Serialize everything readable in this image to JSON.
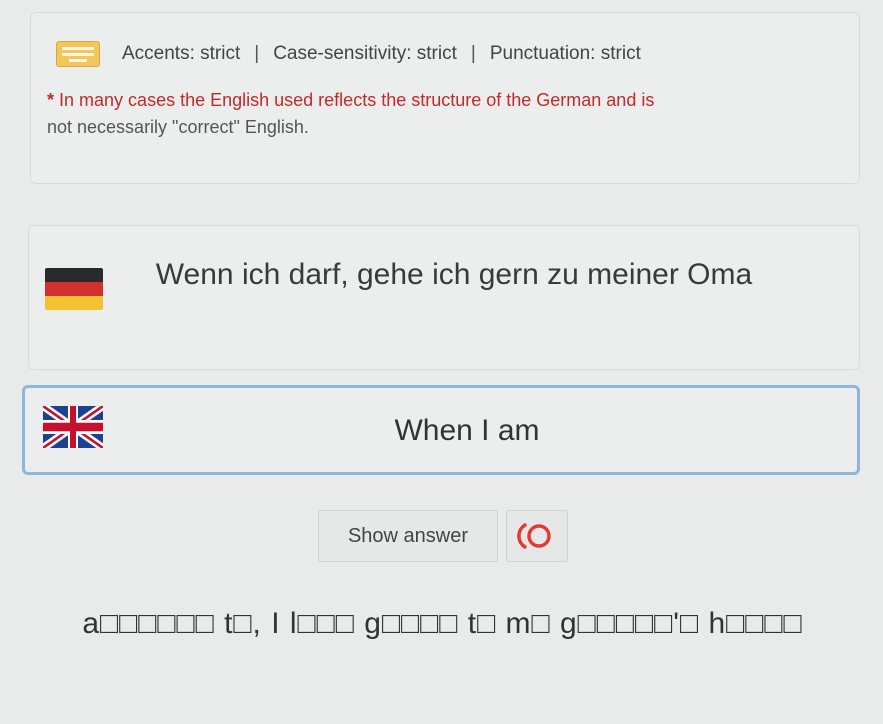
{
  "settings": {
    "accents": "Accents: strict",
    "case": "Case-sensitivity: strict",
    "punctuation": "Punctuation: strict",
    "separator": "|"
  },
  "note": {
    "star": "*",
    "red_text": "In many cases the English used reflects the structure of the German and is",
    "text": "not necessarily \"correct\" English."
  },
  "sentence": {
    "german": "Wenn ich darf, gehe ich gern zu meiner Oma"
  },
  "answer": {
    "value": "When I am"
  },
  "buttons": {
    "show_answer": "Show answer"
  },
  "hint": {
    "text": "a□□□□□□ t□, I l□□□ g□□□□ t□ m□ g□□□□□'□ h□□□□"
  },
  "colors": {
    "accent_border": "#8fb5dc",
    "note_red": "#c62828",
    "audio_icon": "#e53935"
  }
}
